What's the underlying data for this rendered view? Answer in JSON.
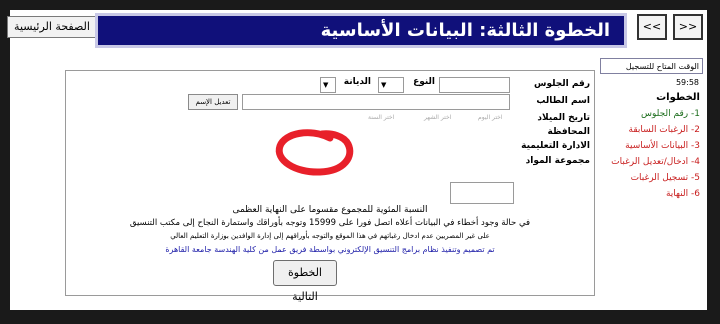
{
  "header": {
    "title": "الخطوة الثالثة: البيانات الأساسية"
  },
  "home_button": "الصفحة الرئيسية",
  "nav": {
    "back": "<<",
    "forward": ">>"
  },
  "timer": {
    "label": "الوقت المتاح للتسجيل",
    "value": "59:58"
  },
  "sidebar": {
    "title": "الخطوات",
    "steps": [
      "1- رقم الجلوس",
      "2- الرغبات السابقة",
      "3- البيانات الأساسية",
      "4- ادخال/تعديل الرغبات",
      "5- تسجيل الرغبات",
      "6- النهاية"
    ]
  },
  "form": {
    "seat_label": "رقم الجلوس",
    "gender_label": "النوع",
    "religion_label": "الديانة",
    "name_label": "اسم الطالب",
    "edit_name_button": "تعديل الإسم",
    "birth_label": "تاريخ الميلاد",
    "day_placeholder": "اختر اليوم",
    "month_placeholder": "اختر الشهر",
    "year_placeholder": "اختر السنة",
    "governorate_label": "المحافظة",
    "admin_label": "الادارة التعليمية",
    "subjects_label": "مجموعة المواد"
  },
  "notes": {
    "percentage": "النسبة المئوية للمجموع مقسوما على النهاية العظمى",
    "error_line1": "في حالة وجود أخطاء في البيانات أعلاه اتصل فورا على 15999 وتوجه بأوراقك واستمارة النجاح إلى مكتب التنسيق",
    "error_line2": "على غير المصريين عدم ادخال رغباتهم في هذا الموقع والتوجه بأوراقهم إلى إدارة الوافدين بوزارة التعليم العالي",
    "credits": "تم تصميم وتنفيذ نظام برامج التنسيق الإلكتروني بواسطة فريق عمل من كلية الهندسة جامعة القاهرة"
  },
  "next_button": "الخطوة التالية",
  "colors": {
    "header_bg": "#10107a",
    "step_red": "#c81e1e",
    "step_green": "#1e6e1e",
    "annotation": "#e8202a"
  }
}
